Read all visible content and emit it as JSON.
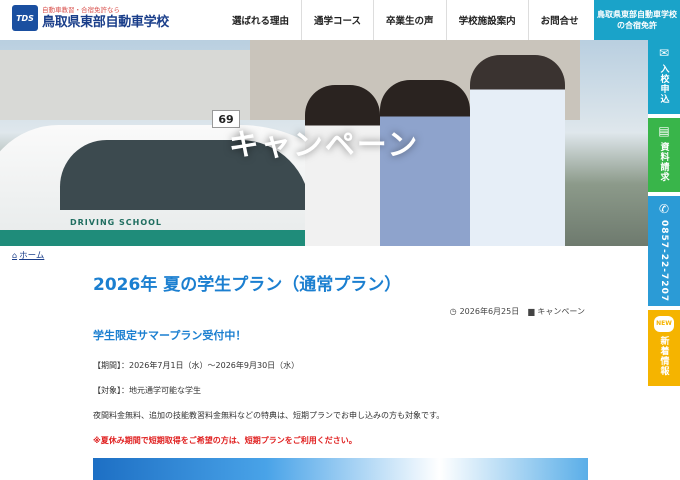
{
  "header": {
    "logo_badge": "TDS",
    "logo_tagline": "自動車教習・合宿免許なら",
    "logo_name": "鳥取県東部自動車学校",
    "nav": [
      "選ばれる理由",
      "通学コース",
      "卒業生の声",
      "学校施設案内",
      "お問合せ"
    ],
    "cta": "鳥取県東部自動車学校の合宿免許"
  },
  "hero": {
    "title": "キャンペーン",
    "plate": "69",
    "car_text": "DRIVING SCHOOL"
  },
  "side": {
    "entry": "入校申込",
    "doc": "資料請求",
    "tel": "0857-22-7207",
    "new_badge": "NEW",
    "new": "新着情報"
  },
  "breadcrumb": {
    "home": "ホーム"
  },
  "post": {
    "title": "2026年 夏の学生プラン（通常プラン）",
    "date": "2026年6月25日",
    "category": "キャンペーン",
    "subhead": "学生限定サマープラン受付中！",
    "period": "【期間】：2026年7月1日（水）〜2026年9月30日（水）",
    "target": "【対象】：地元通学可能な学生",
    "body": "夜間料金無料、追加の技能教習料金無料などの特典は、短期プランでお申し込みの方も対象です。",
    "notice": "※夏休み期間で短期取得をご希望の方は、短期プランをご利用ください。"
  },
  "colors": {
    "brand": "#1a3e8a",
    "accent": "#1aa3c9",
    "title_blue": "#1b7fd0",
    "notice_red": "#e02020",
    "doc_green": "#39b54a",
    "new_yellow": "#f5b400"
  }
}
